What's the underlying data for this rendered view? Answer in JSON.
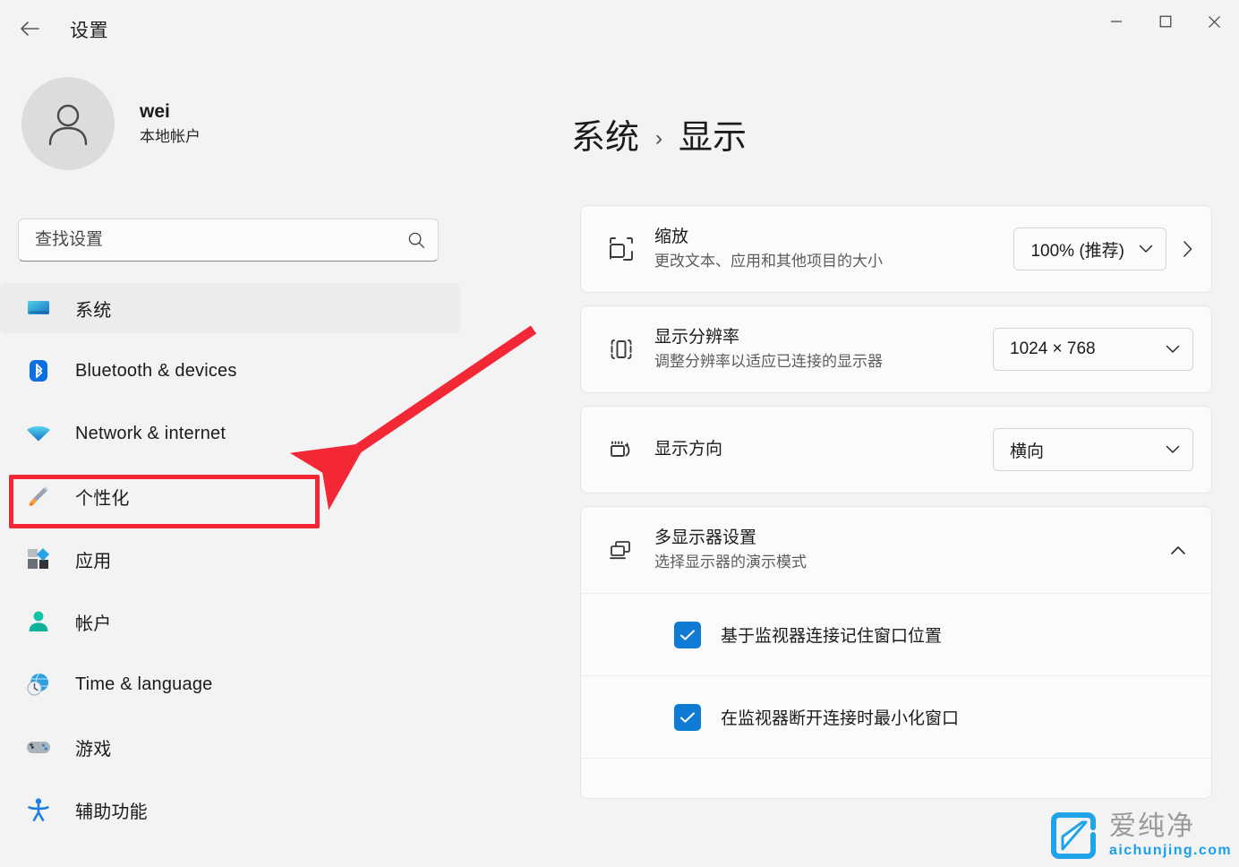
{
  "window": {
    "title": "设置",
    "back_icon": "arrow-left-icon",
    "controls": {
      "minimize": "minimize-icon",
      "maximize": "maximize-icon",
      "close": "close-icon"
    }
  },
  "sidebar": {
    "profile": {
      "avatar_icon": "person-avatar-icon",
      "name": "wei",
      "account_type": "本地帐户"
    },
    "search": {
      "placeholder": "查找设置",
      "value": "",
      "icon": "search-icon"
    },
    "items": [
      {
        "label": "系统",
        "icon": "monitor-icon",
        "active": true
      },
      {
        "label": "Bluetooth & devices",
        "icon": "bluetooth-icon",
        "active": false
      },
      {
        "label": "Network & internet",
        "icon": "wifi-icon",
        "active": false
      },
      {
        "label": "个性化",
        "icon": "paintbrush-icon",
        "active": false
      },
      {
        "label": "应用",
        "icon": "apps-icon",
        "active": false
      },
      {
        "label": "帐户",
        "icon": "account-person-icon",
        "active": false
      },
      {
        "label": "Time & language",
        "icon": "clock-globe-icon",
        "active": false
      },
      {
        "label": "游戏",
        "icon": "gamepad-icon",
        "active": false
      },
      {
        "label": "辅助功能",
        "icon": "accessibility-icon",
        "active": false
      }
    ]
  },
  "main": {
    "breadcrumb": {
      "parent": "系统",
      "separator": "›",
      "current": "显示"
    },
    "cards": [
      {
        "icon": "scale-icon",
        "title": "缩放",
        "subtitle": "更改文本、应用和其他项目的大小",
        "control_type": "combobox",
        "value": "100% (推荐)",
        "chevron_icon": "chevron-down-icon",
        "navigate_icon": "chevron-right-icon"
      },
      {
        "icon": "resolution-icon",
        "title": "显示分辨率",
        "subtitle": "调整分辨率以适应已连接的显示器",
        "control_type": "combobox",
        "value": "1024 × 768",
        "chevron_icon": "chevron-down-icon"
      },
      {
        "icon": "rotate-display-icon",
        "title": "显示方向",
        "subtitle": "",
        "control_type": "combobox",
        "value": "横向",
        "chevron_icon": "chevron-down-icon"
      }
    ],
    "multi_display": {
      "icon": "multi-monitor-icon",
      "title": "多显示器设置",
      "subtitle": "选择显示器的演示模式",
      "expander_icon": "chevron-up-icon",
      "expanded": true,
      "options": [
        {
          "label": "基于监视器连接记住窗口位置",
          "checked": true
        },
        {
          "label": "在监视器断开连接时最小化窗口",
          "checked": true
        }
      ]
    }
  },
  "annotations": {
    "highlight_color": "#f32735",
    "highlight_target": "个性化",
    "arrow_icon": "red-arrow-icon"
  },
  "watermark": {
    "logo_icon": "aichunjing-logo-icon",
    "brand_cn": "爱纯净",
    "brand_url": "aichunjing.com",
    "brand_color": "#1aa0e8"
  }
}
